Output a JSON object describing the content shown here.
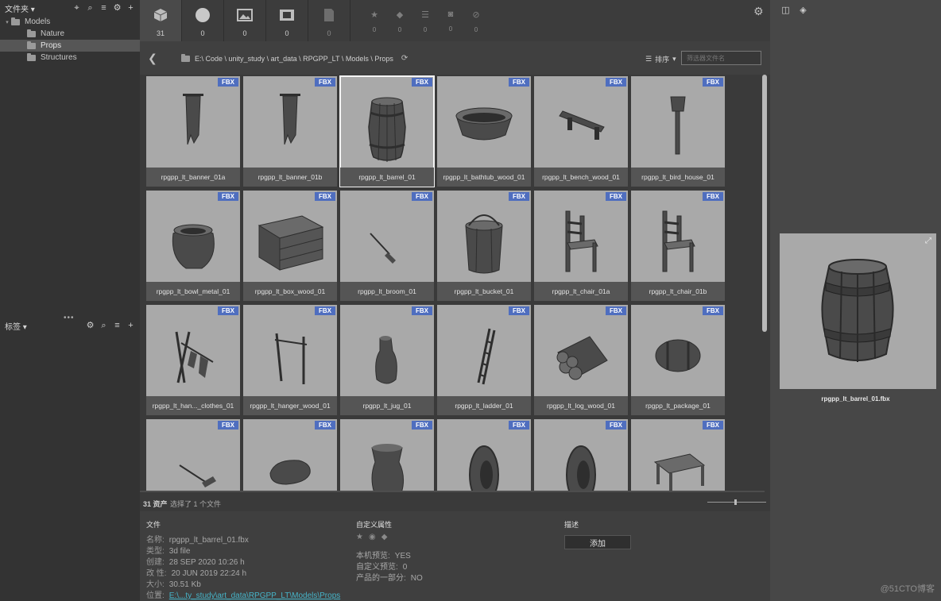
{
  "left_panel": {
    "folders_title": "文件夹",
    "tree": [
      {
        "label": "Models",
        "level": 0
      },
      {
        "label": "Nature",
        "level": 1
      },
      {
        "label": "Props",
        "level": 1,
        "selected": true
      },
      {
        "label": "Structures",
        "level": 1
      }
    ],
    "tags_title": "标签"
  },
  "toolbar": {
    "types": [
      {
        "icon": "cube-icon",
        "count": "31",
        "active": true
      },
      {
        "icon": "sphere-icon",
        "count": "0"
      },
      {
        "icon": "image-icon",
        "count": "0"
      },
      {
        "icon": "film-icon",
        "count": "0"
      },
      {
        "icon": "document-icon",
        "count": "0"
      }
    ],
    "filters": [
      {
        "icon": "star-icon",
        "count": "0"
      },
      {
        "icon": "tag-icon",
        "count": "0"
      },
      {
        "icon": "list-icon",
        "count": "0"
      },
      {
        "icon": "camera-icon",
        "count": "0"
      },
      {
        "icon": "blocked-icon",
        "count": "0"
      }
    ]
  },
  "path": {
    "segments": [
      "E:\\ Code",
      "unity_study",
      "art_data",
      "RPGPP_LT",
      "Models",
      "Props"
    ],
    "sort_label": "排序",
    "filter_placeholder": "筛选器文件名"
  },
  "assets": [
    {
      "name": "rpgpp_lt_banner_01a",
      "badge": "FBX",
      "shape": "banner"
    },
    {
      "name": "rpgpp_lt_banner_01b",
      "badge": "FBX",
      "shape": "banner"
    },
    {
      "name": "rpgpp_lt_barrel_01",
      "badge": "FBX",
      "shape": "barrel",
      "selected": true
    },
    {
      "name": "rpgpp_lt_bathtub_wood_01",
      "badge": "FBX",
      "shape": "tub"
    },
    {
      "name": "rpgpp_lt_bench_wood_01",
      "badge": "FBX",
      "shape": "bench"
    },
    {
      "name": "rpgpp_lt_bird_house_01",
      "badge": "FBX",
      "shape": "birdhouse"
    },
    {
      "name": "rpgpp_lt_bowl_metal_01",
      "badge": "FBX",
      "shape": "pot"
    },
    {
      "name": "rpgpp_lt_box_wood_01",
      "badge": "FBX",
      "shape": "crate"
    },
    {
      "name": "rpgpp_lt_broom_01",
      "badge": "FBX",
      "shape": "broom"
    },
    {
      "name": "rpgpp_lt_bucket_01",
      "badge": "FBX",
      "shape": "bucket"
    },
    {
      "name": "rpgpp_lt_chair_01a",
      "badge": "FBX",
      "shape": "chair"
    },
    {
      "name": "rpgpp_lt_chair_01b",
      "badge": "FBX",
      "shape": "chair"
    },
    {
      "name": "rpgpp_lt_han..._clothes_01",
      "badge": "FBX",
      "shape": "rack"
    },
    {
      "name": "rpgpp_lt_hanger_wood_01",
      "badge": "FBX",
      "shape": "hanger"
    },
    {
      "name": "rpgpp_lt_jug_01",
      "badge": "FBX",
      "shape": "jug"
    },
    {
      "name": "rpgpp_lt_ladder_01",
      "badge": "FBX",
      "shape": "ladder"
    },
    {
      "name": "rpgpp_lt_log_wood_01",
      "badge": "FBX",
      "shape": "logs"
    },
    {
      "name": "rpgpp_lt_package_01",
      "badge": "FBX",
      "shape": "package"
    },
    {
      "name": "",
      "badge": "FBX",
      "shape": "rake"
    },
    {
      "name": "",
      "badge": "FBX",
      "shape": "sack"
    },
    {
      "name": "",
      "badge": "FBX",
      "shape": "bag"
    },
    {
      "name": "",
      "badge": "FBX",
      "shape": "shield"
    },
    {
      "name": "",
      "badge": "FBX",
      "shape": "shield"
    },
    {
      "name": "",
      "badge": "FBX",
      "shape": "table"
    }
  ],
  "status": {
    "count": "31 资产",
    "selection": "选择了 1 个文件"
  },
  "details": {
    "file_title": "文件",
    "rows": [
      {
        "key": "名称:",
        "value": "rpgpp_lt_barrel_01.fbx"
      },
      {
        "key": "类型:",
        "value": "3d file"
      },
      {
        "key": "创建:",
        "value": "28 SEP 2020 10:26 h"
      },
      {
        "key": "改 性:",
        "value": "20 JUN 2019 22:24 h"
      },
      {
        "key": "大小:",
        "value": "30.51 Kb"
      },
      {
        "key": "位置:",
        "value": "E:\\...ty_study\\art_data\\RPGPP_LT\\Models\\Props",
        "link": true
      }
    ],
    "custom_title": "自定义属性",
    "props": [
      {
        "key": "本机预览:",
        "value": "YES"
      },
      {
        "key": "自定义预览:",
        "value": "0"
      },
      {
        "key": "产品的一部分:",
        "value": "NO"
      }
    ],
    "desc_title": "描述",
    "add_label": "添加"
  },
  "preview": {
    "name": "rpgpp_lt_barrel_01.fbx"
  },
  "watermark": "@51CTO博客"
}
